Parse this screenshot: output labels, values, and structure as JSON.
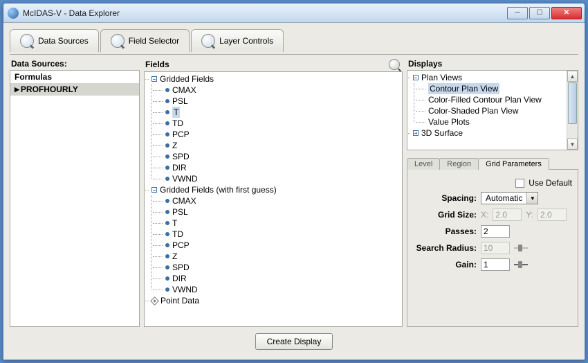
{
  "window": {
    "title": "McIDAS-V - Data Explorer"
  },
  "top_tabs": [
    {
      "label": "Data Sources"
    },
    {
      "label": "Field Selector"
    },
    {
      "label": "Layer Controls"
    }
  ],
  "active_top_tab": 1,
  "data_sources": {
    "label": "Data Sources:",
    "items": [
      "Formulas",
      "PROFHOURLY"
    ],
    "selected": "PROFHOURLY"
  },
  "fields": {
    "label": "Fields",
    "groups": [
      {
        "label": "Gridded Fields",
        "items": [
          "CMAX",
          "PSL",
          "T",
          "TD",
          "PCP",
          "Z",
          "SPD",
          "DIR",
          "VWND"
        ]
      },
      {
        "label": "Gridded Fields (with first guess)",
        "items": [
          "CMAX",
          "PSL",
          "T",
          "TD",
          "PCP",
          "Z",
          "SPD",
          "DIR",
          "VWND"
        ]
      }
    ],
    "extra": "Point Data",
    "selected": "T"
  },
  "displays": {
    "label": "Displays",
    "groups": [
      {
        "label": "Plan Views",
        "items": [
          "Contour Plan View",
          "Color-Filled Contour Plan View",
          "Color-Shaded Plan View",
          "Value Plots"
        ]
      },
      {
        "label": "3D Surface",
        "items": []
      }
    ],
    "selected": "Contour Plan View"
  },
  "param_tabs": {
    "tabs": [
      "Level",
      "Region",
      "Grid Parameters"
    ],
    "active": 2
  },
  "grid_params": {
    "use_default_label": "Use Default",
    "use_default": false,
    "spacing_label": "Spacing:",
    "spacing_value": "Automatic",
    "grid_size_label": "Grid Size:",
    "grid_x_label": "X:",
    "grid_x": "2.0",
    "grid_y_label": "Y:",
    "grid_y": "2.0",
    "passes_label": "Passes:",
    "passes": "2",
    "search_radius_label": "Search Radius:",
    "search_radius": "10",
    "gain_label": "Gain:",
    "gain": "1"
  },
  "create_button": "Create Display"
}
